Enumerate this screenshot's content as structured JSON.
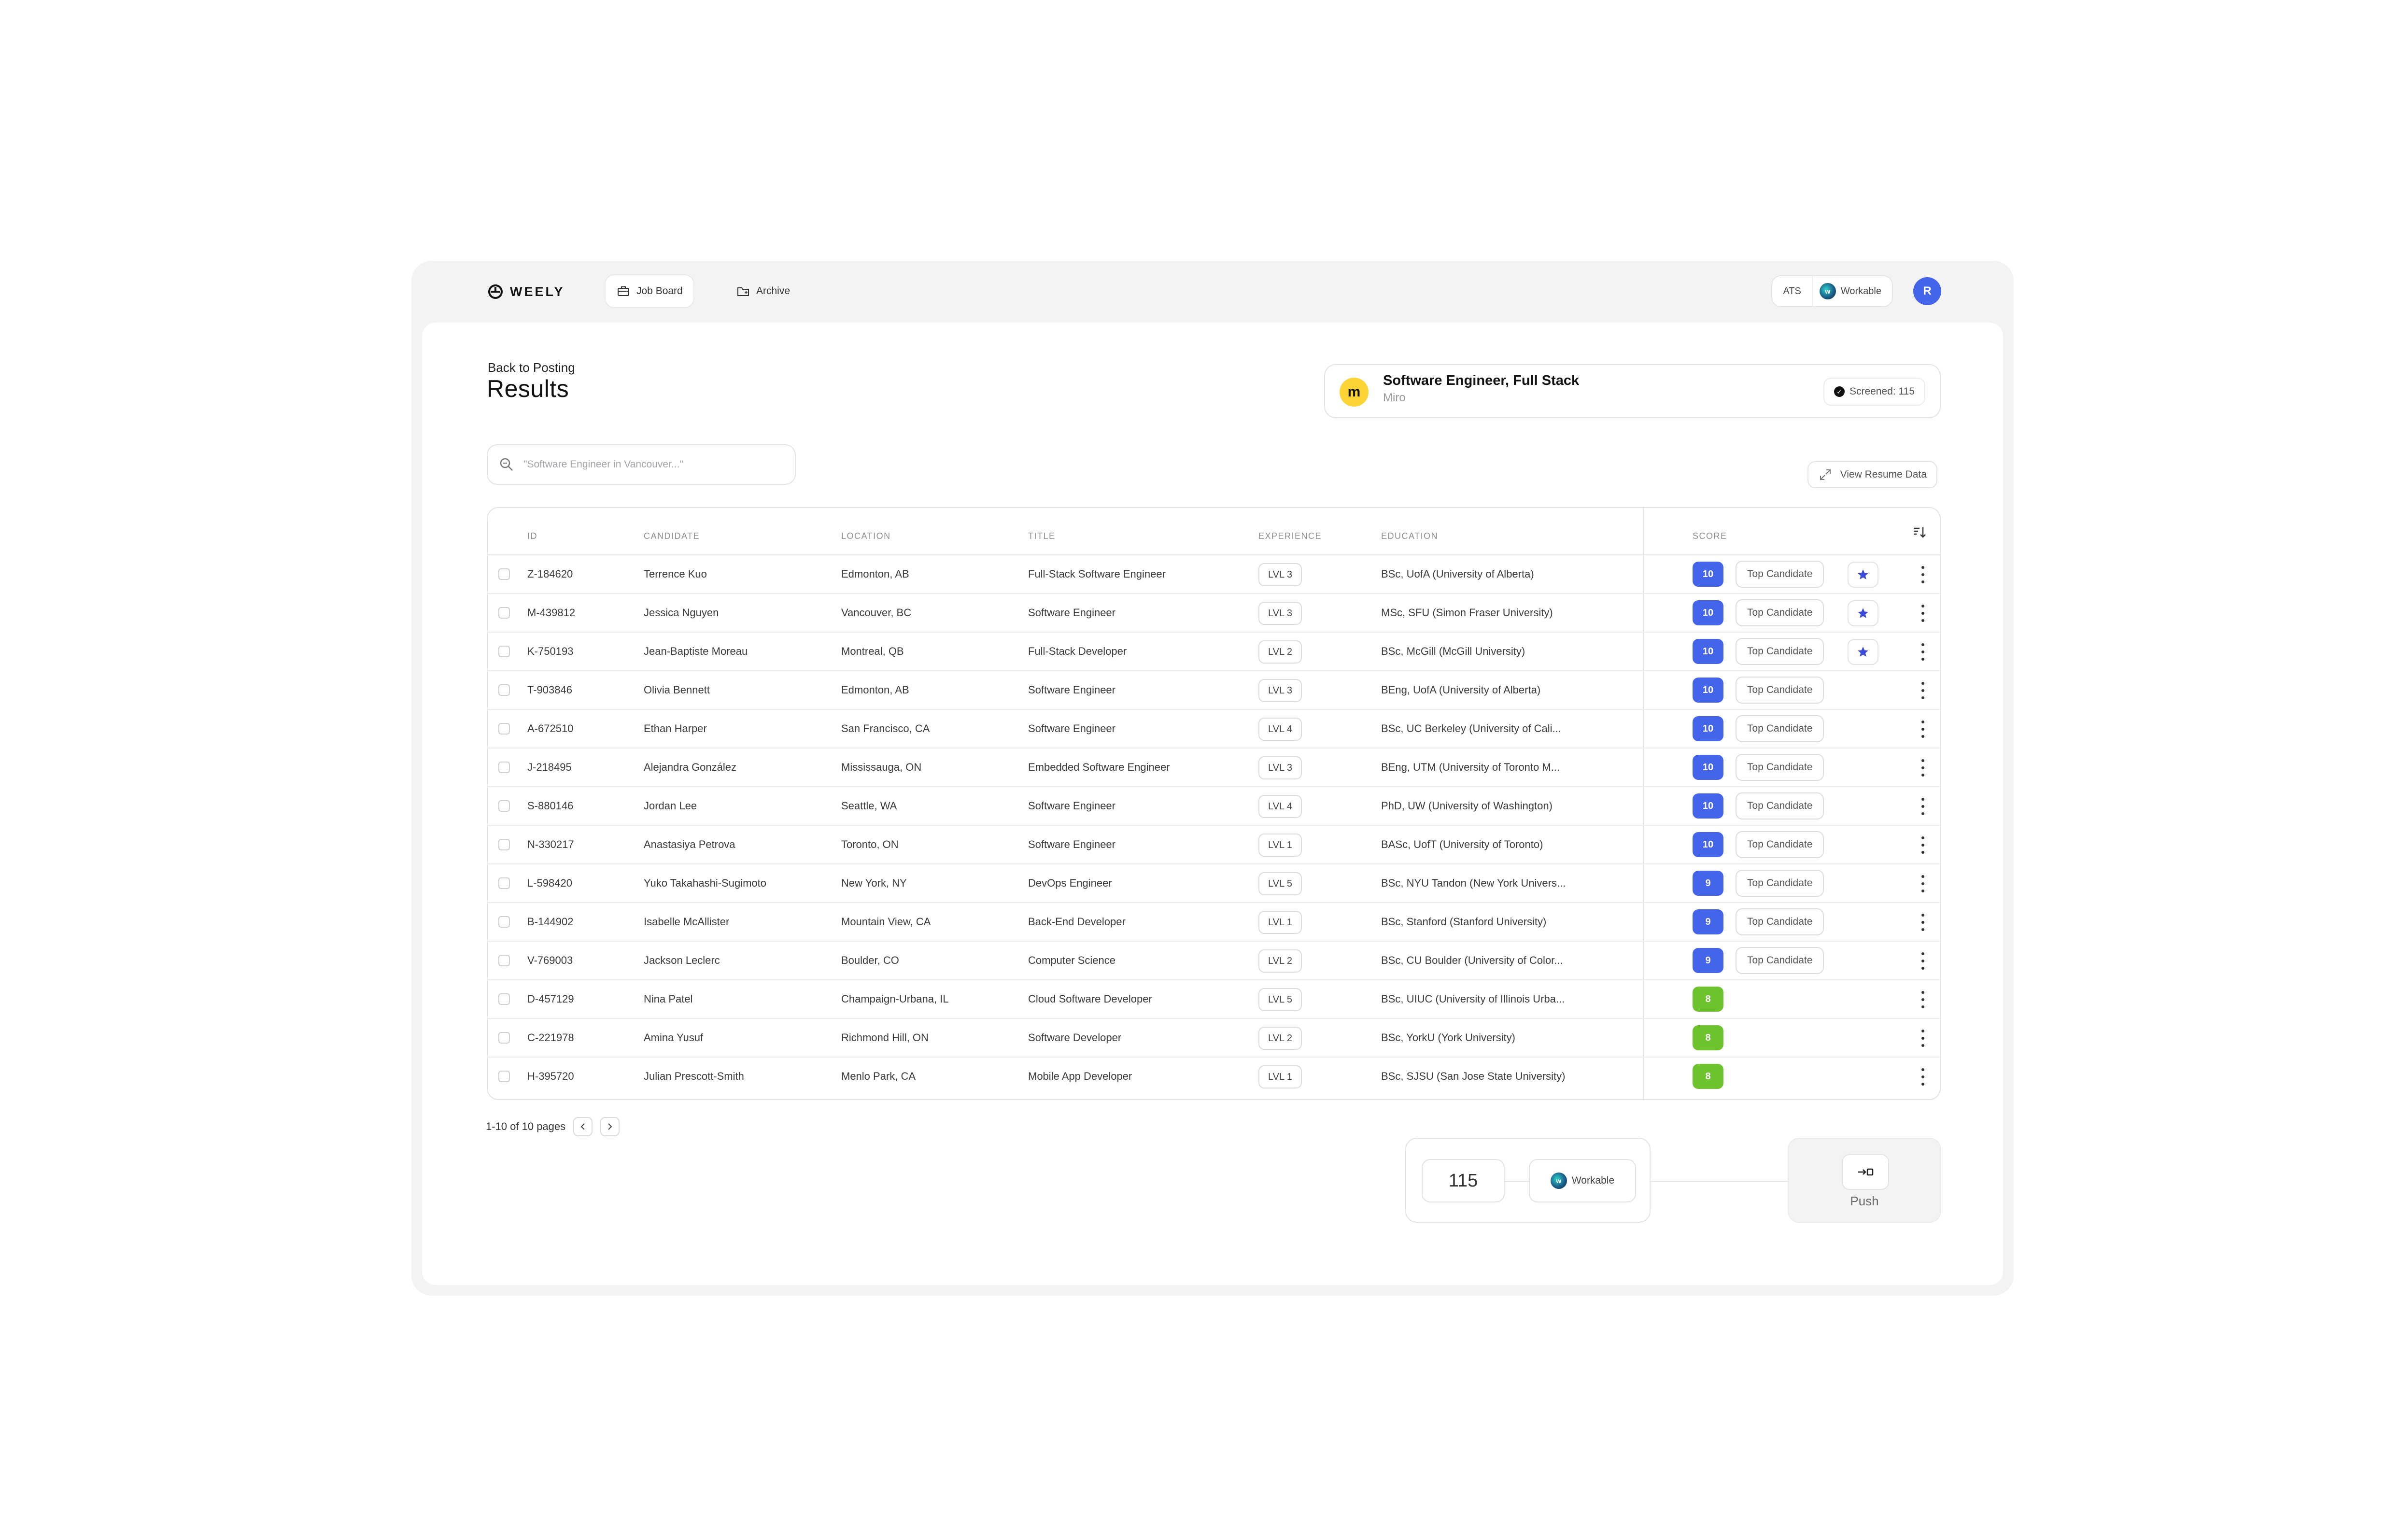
{
  "brand": {
    "name": "WEELY"
  },
  "nav": {
    "job_board": "Job Board",
    "archive": "Archive"
  },
  "ats": {
    "label": "ATS",
    "provider": "Workable"
  },
  "user": {
    "initial": "R"
  },
  "header": {
    "back_link": "Back to Posting",
    "title": "Results"
  },
  "job": {
    "title": "Software Engineer, Full Stack",
    "company": "Miro",
    "screened_label": "Screened: 115"
  },
  "search": {
    "placeholder": "\"Software Engineer in Vancouver...\""
  },
  "view_resume": "View Resume Data",
  "table": {
    "columns": [
      "ID",
      "CANDIDATE",
      "LOCATION",
      "TITLE",
      "EXPERIENCE",
      "EDUCATION",
      "SCORE"
    ],
    "rows": [
      {
        "id": "Z-184620",
        "candidate": "Terrence Kuo",
        "location": "Edmonton, AB",
        "title": "Full-Stack Software Engineer",
        "experience": "LVL 3",
        "education": "BSc, UofA (University of Alberta)",
        "score": "10",
        "tag": "Top Candidate",
        "starred": true
      },
      {
        "id": "M-439812",
        "candidate": "Jessica Nguyen",
        "location": "Vancouver, BC",
        "title": "Software Engineer",
        "experience": "LVL 3",
        "education": "MSc, SFU (Simon Fraser University)",
        "score": "10",
        "tag": "Top Candidate",
        "starred": true
      },
      {
        "id": "K-750193",
        "candidate": "Jean-Baptiste Moreau",
        "location": "Montreal, QB",
        "title": "Full-Stack Developer",
        "experience": "LVL 2",
        "education": "BSc, McGill (McGill University)",
        "score": "10",
        "tag": "Top Candidate",
        "starred": true
      },
      {
        "id": "T-903846",
        "candidate": "Olivia Bennett",
        "location": "Edmonton, AB",
        "title": "Software Engineer",
        "experience": "LVL 3",
        "education": "BEng, UofA (University of Alberta)",
        "score": "10",
        "tag": "Top Candidate",
        "starred": false
      },
      {
        "id": "A-672510",
        "candidate": "Ethan Harper",
        "location": "San Francisco, CA",
        "title": "Software Engineer",
        "experience": "LVL 4",
        "education": "BSc, UC Berkeley (University of Cali...",
        "score": "10",
        "tag": "Top Candidate",
        "starred": false
      },
      {
        "id": "J-218495",
        "candidate": "Alejandra González",
        "location": "Mississauga, ON",
        "title": "Embedded Software Engineer",
        "experience": "LVL 3",
        "education": "BEng, UTM (University of Toronto M...",
        "score": "10",
        "tag": "Top Candidate",
        "starred": false
      },
      {
        "id": "S-880146",
        "candidate": "Jordan Lee",
        "location": "Seattle, WA",
        "title": "Software Engineer",
        "experience": "LVL 4",
        "education": "PhD, UW (University of Washington)",
        "score": "10",
        "tag": "Top Candidate",
        "starred": false
      },
      {
        "id": "N-330217",
        "candidate": "Anastasiya Petrova",
        "location": "Toronto, ON",
        "title": "Software Engineer",
        "experience": "LVL 1",
        "education": "BASc, UofT (University of Toronto)",
        "score": "10",
        "tag": "Top Candidate",
        "starred": false
      },
      {
        "id": "L-598420",
        "candidate": "Yuko Takahashi-Sugimoto",
        "location": "New York, NY",
        "title": "DevOps Engineer",
        "experience": "LVL 5",
        "education": "BSc, NYU Tandon (New York Univers...",
        "score": "9",
        "tag": "Top Candidate",
        "starred": false
      },
      {
        "id": "B-144902",
        "candidate": "Isabelle McAllister",
        "location": "Mountain View, CA",
        "title": "Back-End Developer",
        "experience": "LVL 1",
        "education": "BSc, Stanford (Stanford University)",
        "score": "9",
        "tag": "Top Candidate",
        "starred": false
      },
      {
        "id": "V-769003",
        "candidate": "Jackson Leclerc",
        "location": "Boulder, CO",
        "title": "Computer Science",
        "experience": "LVL 2",
        "education": "BSc, CU Boulder (University of Color...",
        "score": "9",
        "tag": "Top Candidate",
        "starred": false
      },
      {
        "id": "D-457129",
        "candidate": "Nina Patel",
        "location": "Champaign-Urbana, IL",
        "title": "Cloud Software Developer",
        "experience": "LVL 5",
        "education": "BSc, UIUC (University of Illinois Urba...",
        "score": "8",
        "tag": "",
        "starred": false
      },
      {
        "id": "C-221978",
        "candidate": "Amina Yusuf",
        "location": "Richmond Hill, ON",
        "title": "Software Developer",
        "experience": "LVL 2",
        "education": "BSc, YorkU (York University)",
        "score": "8",
        "tag": "",
        "starred": false
      },
      {
        "id": "H-395720",
        "candidate": "Julian Prescott-Smith",
        "location": "Menlo Park, CA",
        "title": "Mobile App Developer",
        "experience": "LVL 1",
        "education": "BSc, SJSU (San Jose State University)",
        "score": "8",
        "tag": "",
        "starred": false
      }
    ]
  },
  "pagination": {
    "label": "1-10 of 10 pages"
  },
  "push": {
    "count": "115",
    "provider": "Workable",
    "action_label": "Push"
  },
  "colors": {
    "score_high": "#4465ea",
    "score_mid": "#6cc32e",
    "star": "#3b4bd8",
    "avatar": "#4465ea"
  },
  "icons": {
    "logo": "weely-logo-icon",
    "job_board": "briefcase-icon",
    "archive": "folder-icon",
    "search": "search-icon",
    "expand": "expand-icon",
    "sort": "sort-icon",
    "star": "star-icon",
    "more": "kebab-icon",
    "push": "push-arrow-icon"
  }
}
